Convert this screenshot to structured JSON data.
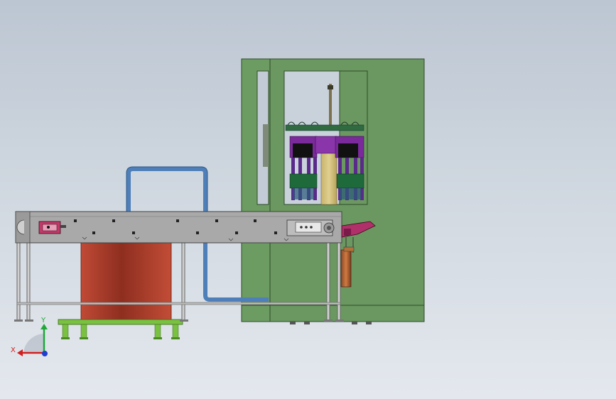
{
  "viewport": {
    "background_top": "#bcc6d2",
    "background_bottom": "#e4e8ee"
  },
  "colors": {
    "frame_green": "#6a9860",
    "frame_green_dark": "#4d7446",
    "conveyor_gray": "#a9a9a9",
    "tank_red": "#b3402e",
    "pipe_blue": "#4f7fb8",
    "base_green": "#7ac142",
    "purple": "#7a2a9a",
    "dark_green": "#1e6a3a",
    "chute_magenta": "#b0306a"
  },
  "triad": {
    "x_label": "X",
    "y_label": "Y",
    "x_color": "#d11f1f",
    "y_color": "#1fa83a",
    "z_color": "#1f3fd1"
  }
}
